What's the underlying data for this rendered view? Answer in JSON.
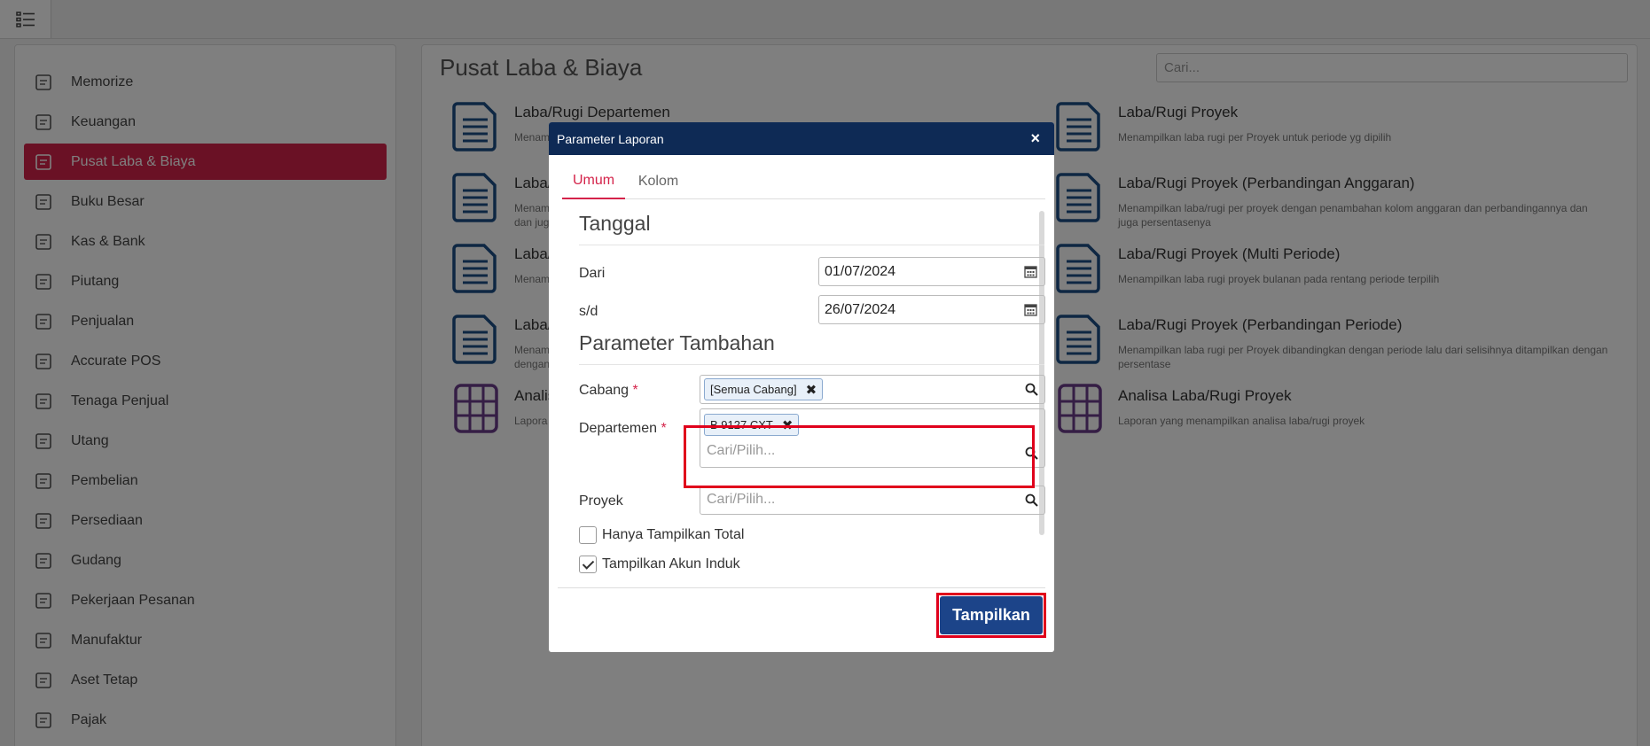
{
  "sidebar": {
    "items": [
      {
        "label": "Memorize",
        "icon": "save-icon"
      },
      {
        "label": "Keuangan",
        "icon": "money-bag-icon"
      },
      {
        "label": "Pusat Laba & Biaya",
        "icon": "building-icon",
        "active": true
      },
      {
        "label": "Buku Besar",
        "icon": "ledger-icon"
      },
      {
        "label": "Kas & Bank",
        "icon": "cash-icon"
      },
      {
        "label": "Piutang",
        "icon": "receivable-icon"
      },
      {
        "label": "Penjualan",
        "icon": "cart-icon"
      },
      {
        "label": "Accurate POS",
        "icon": "pos-icon"
      },
      {
        "label": "Tenaga Penjual",
        "icon": "salesperson-icon"
      },
      {
        "label": "Utang",
        "icon": "payable-icon"
      },
      {
        "label": "Pembelian",
        "icon": "purchase-icon"
      },
      {
        "label": "Persediaan",
        "icon": "inventory-icon"
      },
      {
        "label": "Gudang",
        "icon": "warehouse-icon"
      },
      {
        "label": "Pekerjaan Pesanan",
        "icon": "job-order-icon"
      },
      {
        "label": "Manufaktur",
        "icon": "manufacture-icon"
      },
      {
        "label": "Aset Tetap",
        "icon": "fixed-asset-icon"
      },
      {
        "label": "Pajak",
        "icon": "tax-icon"
      }
    ]
  },
  "main": {
    "title": "Pusat Laba & Biaya",
    "search_placeholder": "Cari...",
    "reports_left": [
      {
        "title": "Laba/Rugi Departemen",
        "desc": "Menam"
      },
      {
        "title": "Laba/",
        "desc": "Menam",
        "desc2": "dan jug"
      },
      {
        "title": "Laba/",
        "desc": "Menam"
      },
      {
        "title": "Laba/",
        "desc": "Menam",
        "desc2": "dengan"
      },
      {
        "title": "Analis",
        "desc": "Lapora",
        "grid": true
      }
    ],
    "reports_right": [
      {
        "title": "Laba/Rugi Proyek",
        "desc": "Menampilkan laba rugi per Proyek untuk periode yg dipilih"
      },
      {
        "title": "Laba/Rugi Proyek (Perbandingan Anggaran)",
        "desc": "Menampilkan laba/rugi per proyek dengan penambahan kolom anggaran dan perbandingannya dan",
        "desc2": "juga persentasenya"
      },
      {
        "title": "Laba/Rugi Proyek (Multi Periode)",
        "desc": "Menampilkan laba rugi proyek bulanan pada rentang periode terpilih"
      },
      {
        "title": "Laba/Rugi Proyek (Perbandingan Periode)",
        "desc": "Menampilkan laba rugi per Proyek dibandingkan dengan periode lalu dari selisihnya ditampilkan dengan",
        "desc2": "persentase"
      },
      {
        "title": "Analisa Laba/Rugi Proyek",
        "desc": "Laporan yang menampilkan analisa laba/rugi proyek",
        "grid": true
      }
    ]
  },
  "modal": {
    "title": "Parameter Laporan",
    "close": "×",
    "tabs": [
      "Umum",
      "Kolom"
    ],
    "section_tanggal": "Tanggal",
    "dari_label": "Dari",
    "dari_value": "01/07/2024",
    "sd_label": "s/d",
    "sd_value": "26/07/2024",
    "section_param": "Parameter Tambahan",
    "cabang_label": "Cabang",
    "cabang_tag": "[Semua Cabang]",
    "departemen_label": "Departemen",
    "departemen_tag": "B 9127 CXT",
    "departemen_placeholder": "Cari/Pilih...",
    "proyek_label": "Proyek",
    "proyek_placeholder": "Cari/Pilih...",
    "required_mark": "*",
    "tag_remove": "✖",
    "check_total": "Hanya Tampilkan Total",
    "check_induk": "Tampilkan Akun Induk",
    "submit": "Tampilkan"
  },
  "colors": {
    "accent": "#d4234a",
    "header": "#0e2a55",
    "button": "#1c4489",
    "highlight": "#e0001b"
  }
}
